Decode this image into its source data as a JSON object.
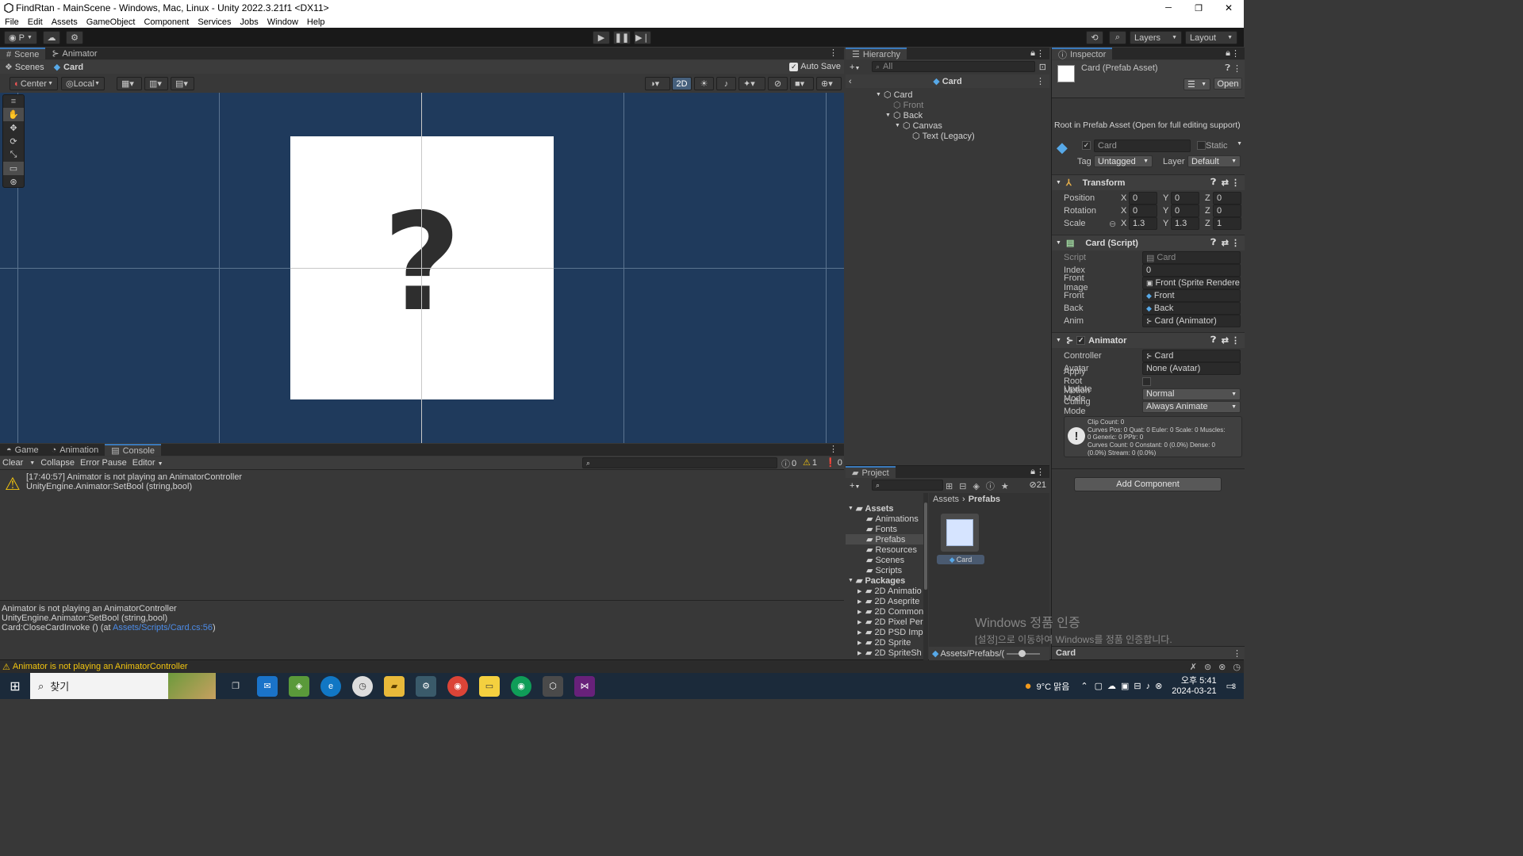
{
  "window": {
    "title": "FindRtan - MainScene - Windows, Mac, Linux - Unity 2022.3.21f1 <DX11>",
    "controls": [
      "─",
      "❐",
      "✕"
    ]
  },
  "menu": [
    "File",
    "Edit",
    "Assets",
    "GameObject",
    "Component",
    "Services",
    "Jobs",
    "Window",
    "Help"
  ],
  "toolbar": {
    "account": "P",
    "layers": "Layers",
    "layout": "Layout"
  },
  "scene": {
    "tabs": [
      "Scene",
      "Animator"
    ],
    "breadcrumb": [
      "Scenes",
      "Card"
    ],
    "auto_save": "Auto Save",
    "pivot": "Center",
    "space": "Local",
    "mode_2d": "2D",
    "card_glyph": "?"
  },
  "console": {
    "tabs": [
      "Game",
      "Animation",
      "Console"
    ],
    "buttons": [
      "Clear",
      "Collapse",
      "Error Pause",
      "Editor"
    ],
    "counts": {
      "info": "0",
      "warn": "1",
      "error": "0"
    },
    "entry": {
      "line1": "[17:40:57] Animator is not playing an AnimatorController",
      "line2": "UnityEngine.Animator:SetBool (string,bool)"
    },
    "detail": {
      "line1": "Animator is not playing an AnimatorController",
      "line2": "UnityEngine.Animator:SetBool (string,bool)",
      "line3_prefix": "Card:CloseCardInvoke () (at ",
      "line3_link": "Assets/Scripts/Card.cs:56",
      "line3_suffix": ")"
    },
    "status": "Animator is not playing an AnimatorController"
  },
  "hierarchy": {
    "title": "Hierarchy",
    "search_placeholder": "All",
    "header": "Card",
    "items": [
      {
        "label": "Card",
        "depth": 0,
        "arrow": "▼"
      },
      {
        "label": "Front",
        "depth": 1,
        "arrow": ""
      },
      {
        "label": "Back",
        "depth": 1,
        "arrow": "▼"
      },
      {
        "label": "Canvas",
        "depth": 2,
        "arrow": "▼"
      },
      {
        "label": "Text (Legacy)",
        "depth": 3,
        "arrow": ""
      }
    ]
  },
  "project": {
    "title": "Project",
    "badge": "21",
    "breadcrumb": [
      "Assets",
      "Prefabs"
    ],
    "tree": [
      {
        "label": "Assets",
        "depth": 0,
        "arrow": "▼",
        "bold": true
      },
      {
        "label": "Animations",
        "depth": 1,
        "arrow": ""
      },
      {
        "label": "Fonts",
        "depth": 1,
        "arrow": ""
      },
      {
        "label": "Prefabs",
        "depth": 1,
        "arrow": "",
        "selected": true
      },
      {
        "label": "Resources",
        "depth": 1,
        "arrow": ""
      },
      {
        "label": "Scenes",
        "depth": 1,
        "arrow": ""
      },
      {
        "label": "Scripts",
        "depth": 1,
        "arrow": ""
      },
      {
        "label": "Packages",
        "depth": 0,
        "arrow": "▼",
        "bold": true
      },
      {
        "label": "2D Animatio",
        "depth": 1,
        "arrow": "▶"
      },
      {
        "label": "2D Aseprite",
        "depth": 1,
        "arrow": "▶"
      },
      {
        "label": "2D Common",
        "depth": 1,
        "arrow": "▶"
      },
      {
        "label": "2D Pixel Per",
        "depth": 1,
        "arrow": "▶"
      },
      {
        "label": "2D PSD Imp",
        "depth": 1,
        "arrow": "▶"
      },
      {
        "label": "2D Sprite",
        "depth": 1,
        "arrow": "▶"
      },
      {
        "label": "2D SpriteSh",
        "depth": 1,
        "arrow": "▶"
      }
    ],
    "asset_label": "Card",
    "footer_path": "Assets/Prefabs/("
  },
  "inspector": {
    "title": "Inspector",
    "asset_title": "Card (Prefab Asset)",
    "open": "Open",
    "root_note": "Root in Prefab Asset (Open for full editing support)",
    "name": "Card",
    "static": "Static",
    "tag_label": "Tag",
    "tag": "Untagged",
    "layer_label": "Layer",
    "layer": "Default",
    "transform": {
      "title": "Transform",
      "rows": [
        {
          "label": "Position",
          "x": "0",
          "y": "0",
          "z": "0"
        },
        {
          "label": "Rotation",
          "x": "0",
          "y": "0",
          "z": "0"
        },
        {
          "label": "Scale",
          "x": "1.3",
          "y": "1.3",
          "z": "1"
        }
      ]
    },
    "card_script": {
      "title": "Card (Script)",
      "rows": [
        {
          "label": "Script",
          "value": "Card"
        },
        {
          "label": "Index",
          "value": "0"
        },
        {
          "label": "Front Image",
          "value": "Front (Sprite Renderer)"
        },
        {
          "label": "Front",
          "value": "Front"
        },
        {
          "label": "Back",
          "value": "Back"
        },
        {
          "label": "Anim",
          "value": "Card (Animator)"
        }
      ]
    },
    "animator": {
      "title": "Animator",
      "rows": [
        {
          "label": "Controller",
          "value": "Card"
        },
        {
          "label": "Avatar",
          "value": "None (Avatar)"
        },
        {
          "label": "Apply Root Motion",
          "value": ""
        },
        {
          "label": "Update Mode",
          "value": "Normal"
        },
        {
          "label": "Culling Mode",
          "value": "Always Animate"
        }
      ],
      "info": [
        "Clip Count: 0",
        "Curves Pos: 0 Quat: 0 Euler: 0 Scale: 0 Muscles:",
        "0 Generic: 0 PPtr: 0",
        "Curves Count: 0 Constant: 0 (0.0%) Dense: 0",
        "(0.0%) Stream: 0 (0.0%)"
      ]
    },
    "add_component": "Add Component",
    "footer": "Card"
  },
  "watermark": {
    "line1": "Windows 정품 인증",
    "line2": "[설정]으로 이동하여 Windows를 정품 인증합니다."
  },
  "taskbar": {
    "search": "찾기",
    "weather": "9°C 맑음",
    "time": "오후 5:41",
    "date": "2024-03-21",
    "notif": "3"
  },
  "colors": {
    "scene_bg": "#1f3a5c",
    "accent": "#3a79bb",
    "warn": "#f2c40f",
    "link": "#4c8ce8"
  }
}
